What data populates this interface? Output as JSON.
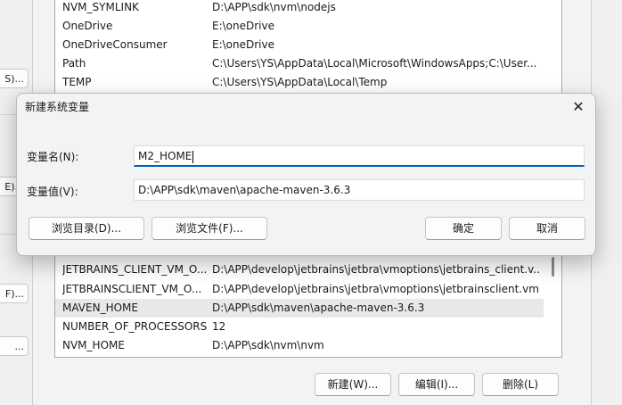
{
  "left_strip": {
    "buttons": [
      "S)...",
      "E)...",
      "F)...",
      "..."
    ]
  },
  "env_list": {
    "rows_top": [
      {
        "name": "NVM_SYMLINK",
        "value": "D:\\APP\\sdk\\nvm\\nodejs"
      },
      {
        "name": "OneDrive",
        "value": "E:\\oneDrive"
      },
      {
        "name": "OneDriveConsumer",
        "value": "E:\\oneDrive"
      },
      {
        "name": "Path",
        "value": "C:\\Users\\YS\\AppData\\Local\\Microsoft\\WindowsApps;C:\\User..."
      },
      {
        "name": "TEMP",
        "value": "C:\\Users\\YS\\AppData\\Local\\Temp"
      }
    ],
    "rows_bottom": [
      {
        "name": "JETBRAINS_CLIENT_VM_O...",
        "value": "D:\\APP\\develop\\jetbrains\\jetbra\\vmoptions\\jetbrains_client.v..."
      },
      {
        "name": "JETBRAINSCLIENT_VM_O...",
        "value": "D:\\APP\\develop\\jetbrains\\jetbra\\vmoptions\\jetbrainsclient.vm..."
      },
      {
        "name": "MAVEN_HOME",
        "value": "D:\\APP\\sdk\\maven\\apache-maven-3.6.3"
      },
      {
        "name": "NUMBER_OF_PROCESSORS",
        "value": "12"
      },
      {
        "name": "NVM_HOME",
        "value": "D:\\APP\\sdk\\nvm\\nvm"
      }
    ],
    "selected": "MAVEN_HOME"
  },
  "env_buttons": {
    "new": "新建(W)...",
    "edit": "编辑(I)...",
    "delete": "删除(L)"
  },
  "dialog": {
    "title": "新建系统变量",
    "close_glyph": "✕",
    "name_label": "变量名(N):",
    "name_value": "M2_HOME",
    "value_label": "变量值(V):",
    "value_value": "D:\\APP\\sdk\\maven\\apache-maven-3.6.3",
    "browse_dir": "浏览目录(D)...",
    "browse_file": "浏览文件(F)...",
    "ok": "确定",
    "cancel": "取消"
  },
  "colors": {
    "accent": "#005fb8",
    "selected_row": "#e8e8e8"
  }
}
